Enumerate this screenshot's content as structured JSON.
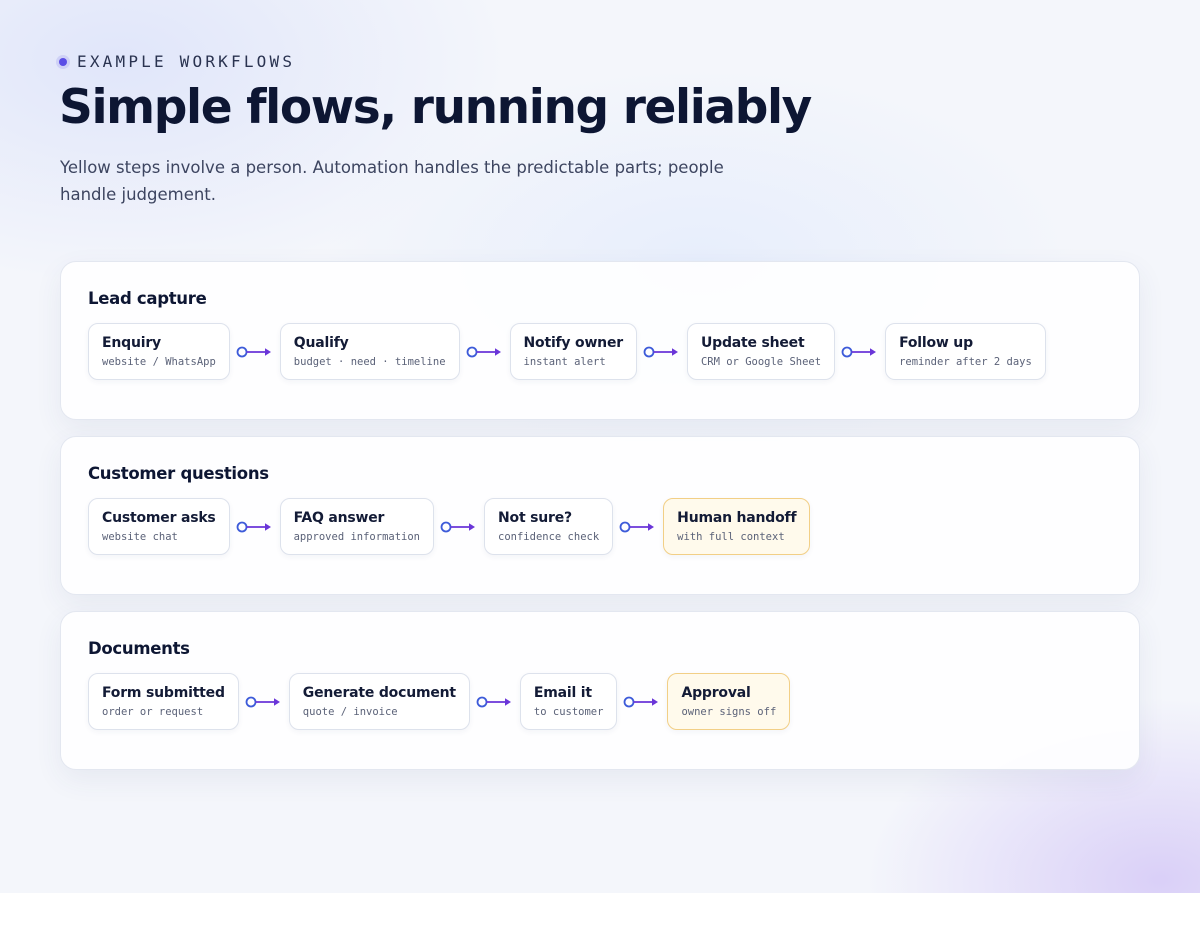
{
  "header": {
    "eyebrow": "EXAMPLE WORKFLOWS",
    "title": "Simple flows, running reliably",
    "subtitle": "Yellow steps involve a person. Automation handles the predictable parts; people handle judgement."
  },
  "colors": {
    "accent": "#5b4ee6",
    "human_step_bg": "#fffaec",
    "human_step_border": "#f2cf86",
    "arrow_circle": "#3d5bd9",
    "arrow_line": "#6a35d8"
  },
  "workflows": [
    {
      "title": "Lead capture",
      "steps": [
        {
          "title": "Enquiry",
          "sub": "website / WhatsApp",
          "human": false
        },
        {
          "title": "Qualify",
          "sub": "budget · need · timeline",
          "human": false
        },
        {
          "title": "Notify owner",
          "sub": "instant alert",
          "human": false
        },
        {
          "title": "Update sheet",
          "sub": "CRM or Google Sheet",
          "human": false
        },
        {
          "title": "Follow up",
          "sub": "reminder after 2 days",
          "human": false
        }
      ]
    },
    {
      "title": "Customer questions",
      "steps": [
        {
          "title": "Customer asks",
          "sub": "website chat",
          "human": false
        },
        {
          "title": "FAQ answer",
          "sub": "approved information",
          "human": false
        },
        {
          "title": "Not sure?",
          "sub": "confidence check",
          "human": false
        },
        {
          "title": "Human handoff",
          "sub": "with full context",
          "human": true
        }
      ]
    },
    {
      "title": "Documents",
      "steps": [
        {
          "title": "Form submitted",
          "sub": "order or request",
          "human": false
        },
        {
          "title": "Generate document",
          "sub": "quote / invoice",
          "human": false
        },
        {
          "title": "Email it",
          "sub": "to customer",
          "human": false
        },
        {
          "title": "Approval",
          "sub": "owner signs off",
          "human": true
        }
      ]
    }
  ]
}
